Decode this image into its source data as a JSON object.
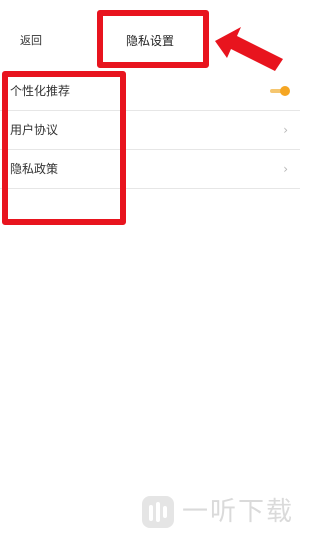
{
  "header": {
    "back_label": "返回",
    "title": "隐私设置"
  },
  "settings": [
    {
      "label": "个性化推荐",
      "control": "toggle",
      "enabled": true
    },
    {
      "label": "用户协议",
      "control": "chevron",
      "chevron": "›"
    },
    {
      "label": "隐私政策",
      "control": "chevron",
      "chevron": "›"
    }
  ],
  "colors": {
    "annotation_red": "#e8141e",
    "toggle_accent": "#f5a623"
  },
  "watermark": {
    "text": "一听下载"
  }
}
